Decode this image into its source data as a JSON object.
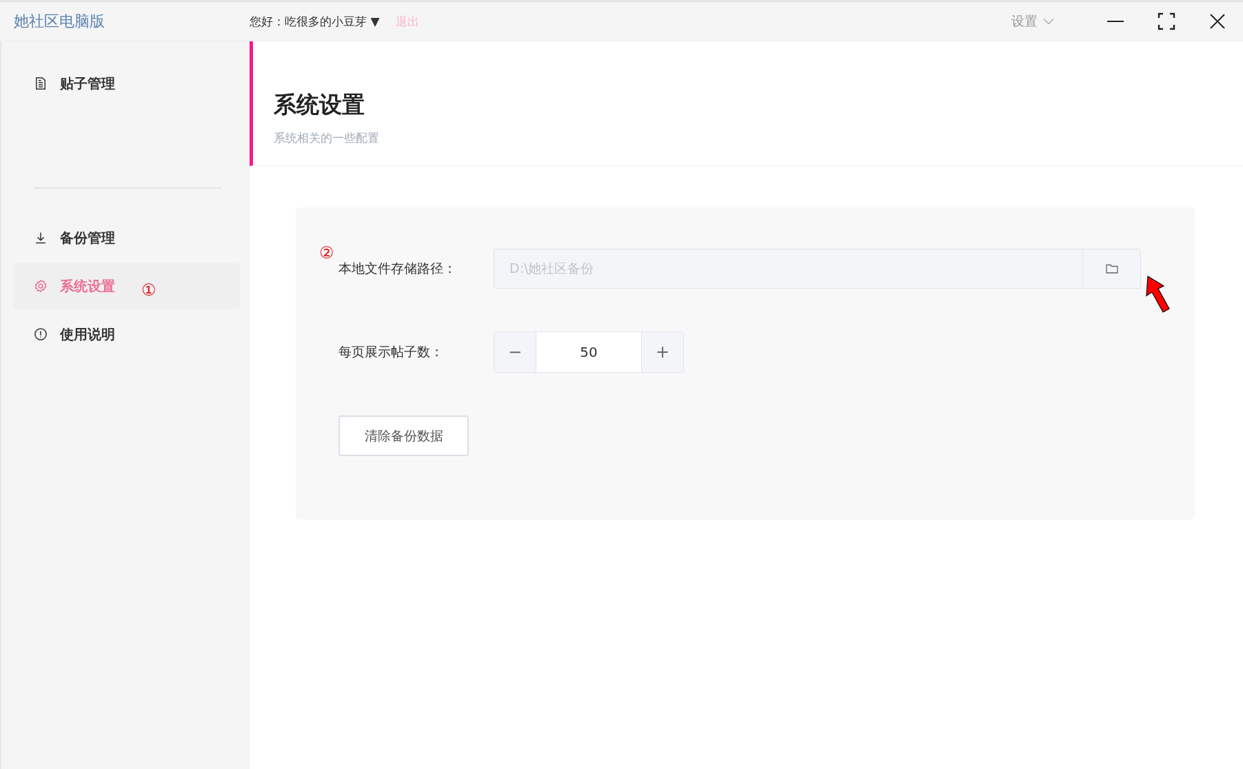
{
  "titlebar": {
    "app_title": "她社区电脑版",
    "greeting": "您好：吃很多的小豆芽 ▼",
    "logout": "退出",
    "settings_menu": "设置"
  },
  "sidebar": {
    "groups": [
      [
        {
          "label": "贴子管理",
          "selected": false
        }
      ],
      [
        {
          "label": "备份管理",
          "selected": false
        },
        {
          "label": "系统设置",
          "selected": true,
          "marker": "①"
        },
        {
          "label": "使用说明",
          "selected": false
        }
      ]
    ]
  },
  "header": {
    "title": "系统设置",
    "subtitle": "系统相关的一些配置"
  },
  "form": {
    "storage_path": {
      "label": "本地文件存储路径：",
      "marker": "②",
      "value": "D:\\她社区备份",
      "disabled": true
    },
    "page_size": {
      "label": "每页展示帖子数：",
      "value": "50",
      "minus": "−",
      "plus": "+"
    },
    "clear_button": "清除备份数据"
  }
}
